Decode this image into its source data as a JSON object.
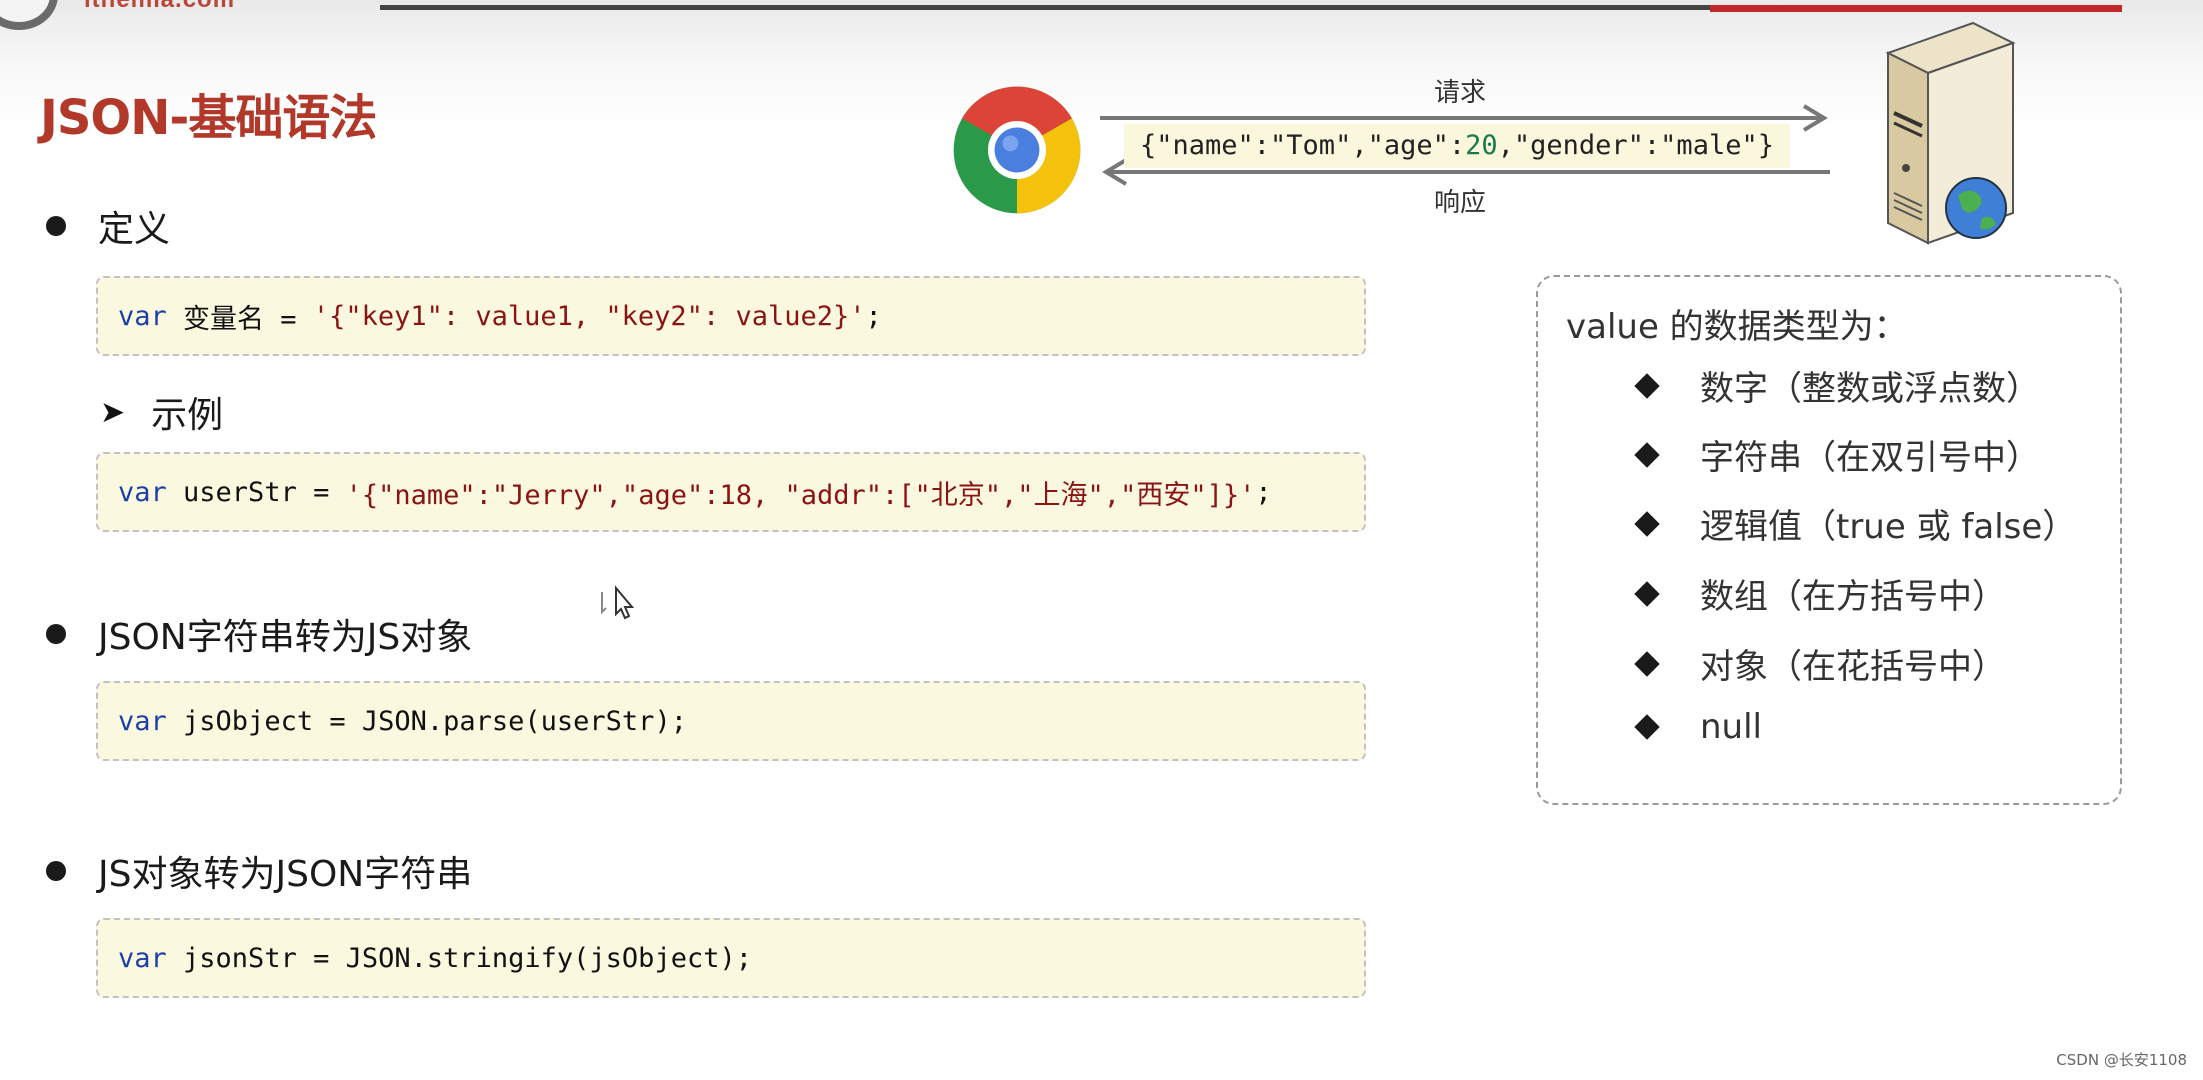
{
  "header": {
    "logo_text": "itheima.com",
    "title": "JSON-基础语法"
  },
  "diagram": {
    "browser_icon": "chrome-icon",
    "server_icon": "server-icon",
    "request_label": "请求",
    "response_label": "响应",
    "json_parts": [
      "{\"name\":\"Tom\",\"age\":",
      "20",
      ",\"gender\":\"male\"}"
    ]
  },
  "sections": {
    "definition": {
      "title": "定义",
      "code": {
        "kw": "var",
        "name": " 变量名 = ",
        "value": "'{\"key1\": value1, \"key2\": value2}'",
        "end": ";"
      }
    },
    "example": {
      "title": "示例",
      "code": {
        "kw": "var",
        "name": " userStr = ",
        "value": "'{\"name\":\"Jerry\",\"age\":18, \"addr\":[\"北京\",\"上海\",\"西安\"]}'",
        "end": ";"
      }
    },
    "parse": {
      "title": "JSON字符串转为JS对象",
      "code": {
        "kw": "var",
        "rest": " jsObject = JSON.parse(userStr);"
      }
    },
    "stringify": {
      "title": "JS对象转为JSON字符串",
      "code": {
        "kw": "var",
        "rest": " jsonStr = JSON.stringify(jsObject);"
      }
    }
  },
  "value_types": {
    "heading": "value 的数据类型为：",
    "items": [
      "数字（整数或浮点数）",
      "字符串（在双引号中）",
      "逻辑值（true 或 false）",
      "数组（在方括号中）",
      "对象（在花括号中）",
      "null"
    ]
  },
  "watermark": "CSDN @长安1108"
}
